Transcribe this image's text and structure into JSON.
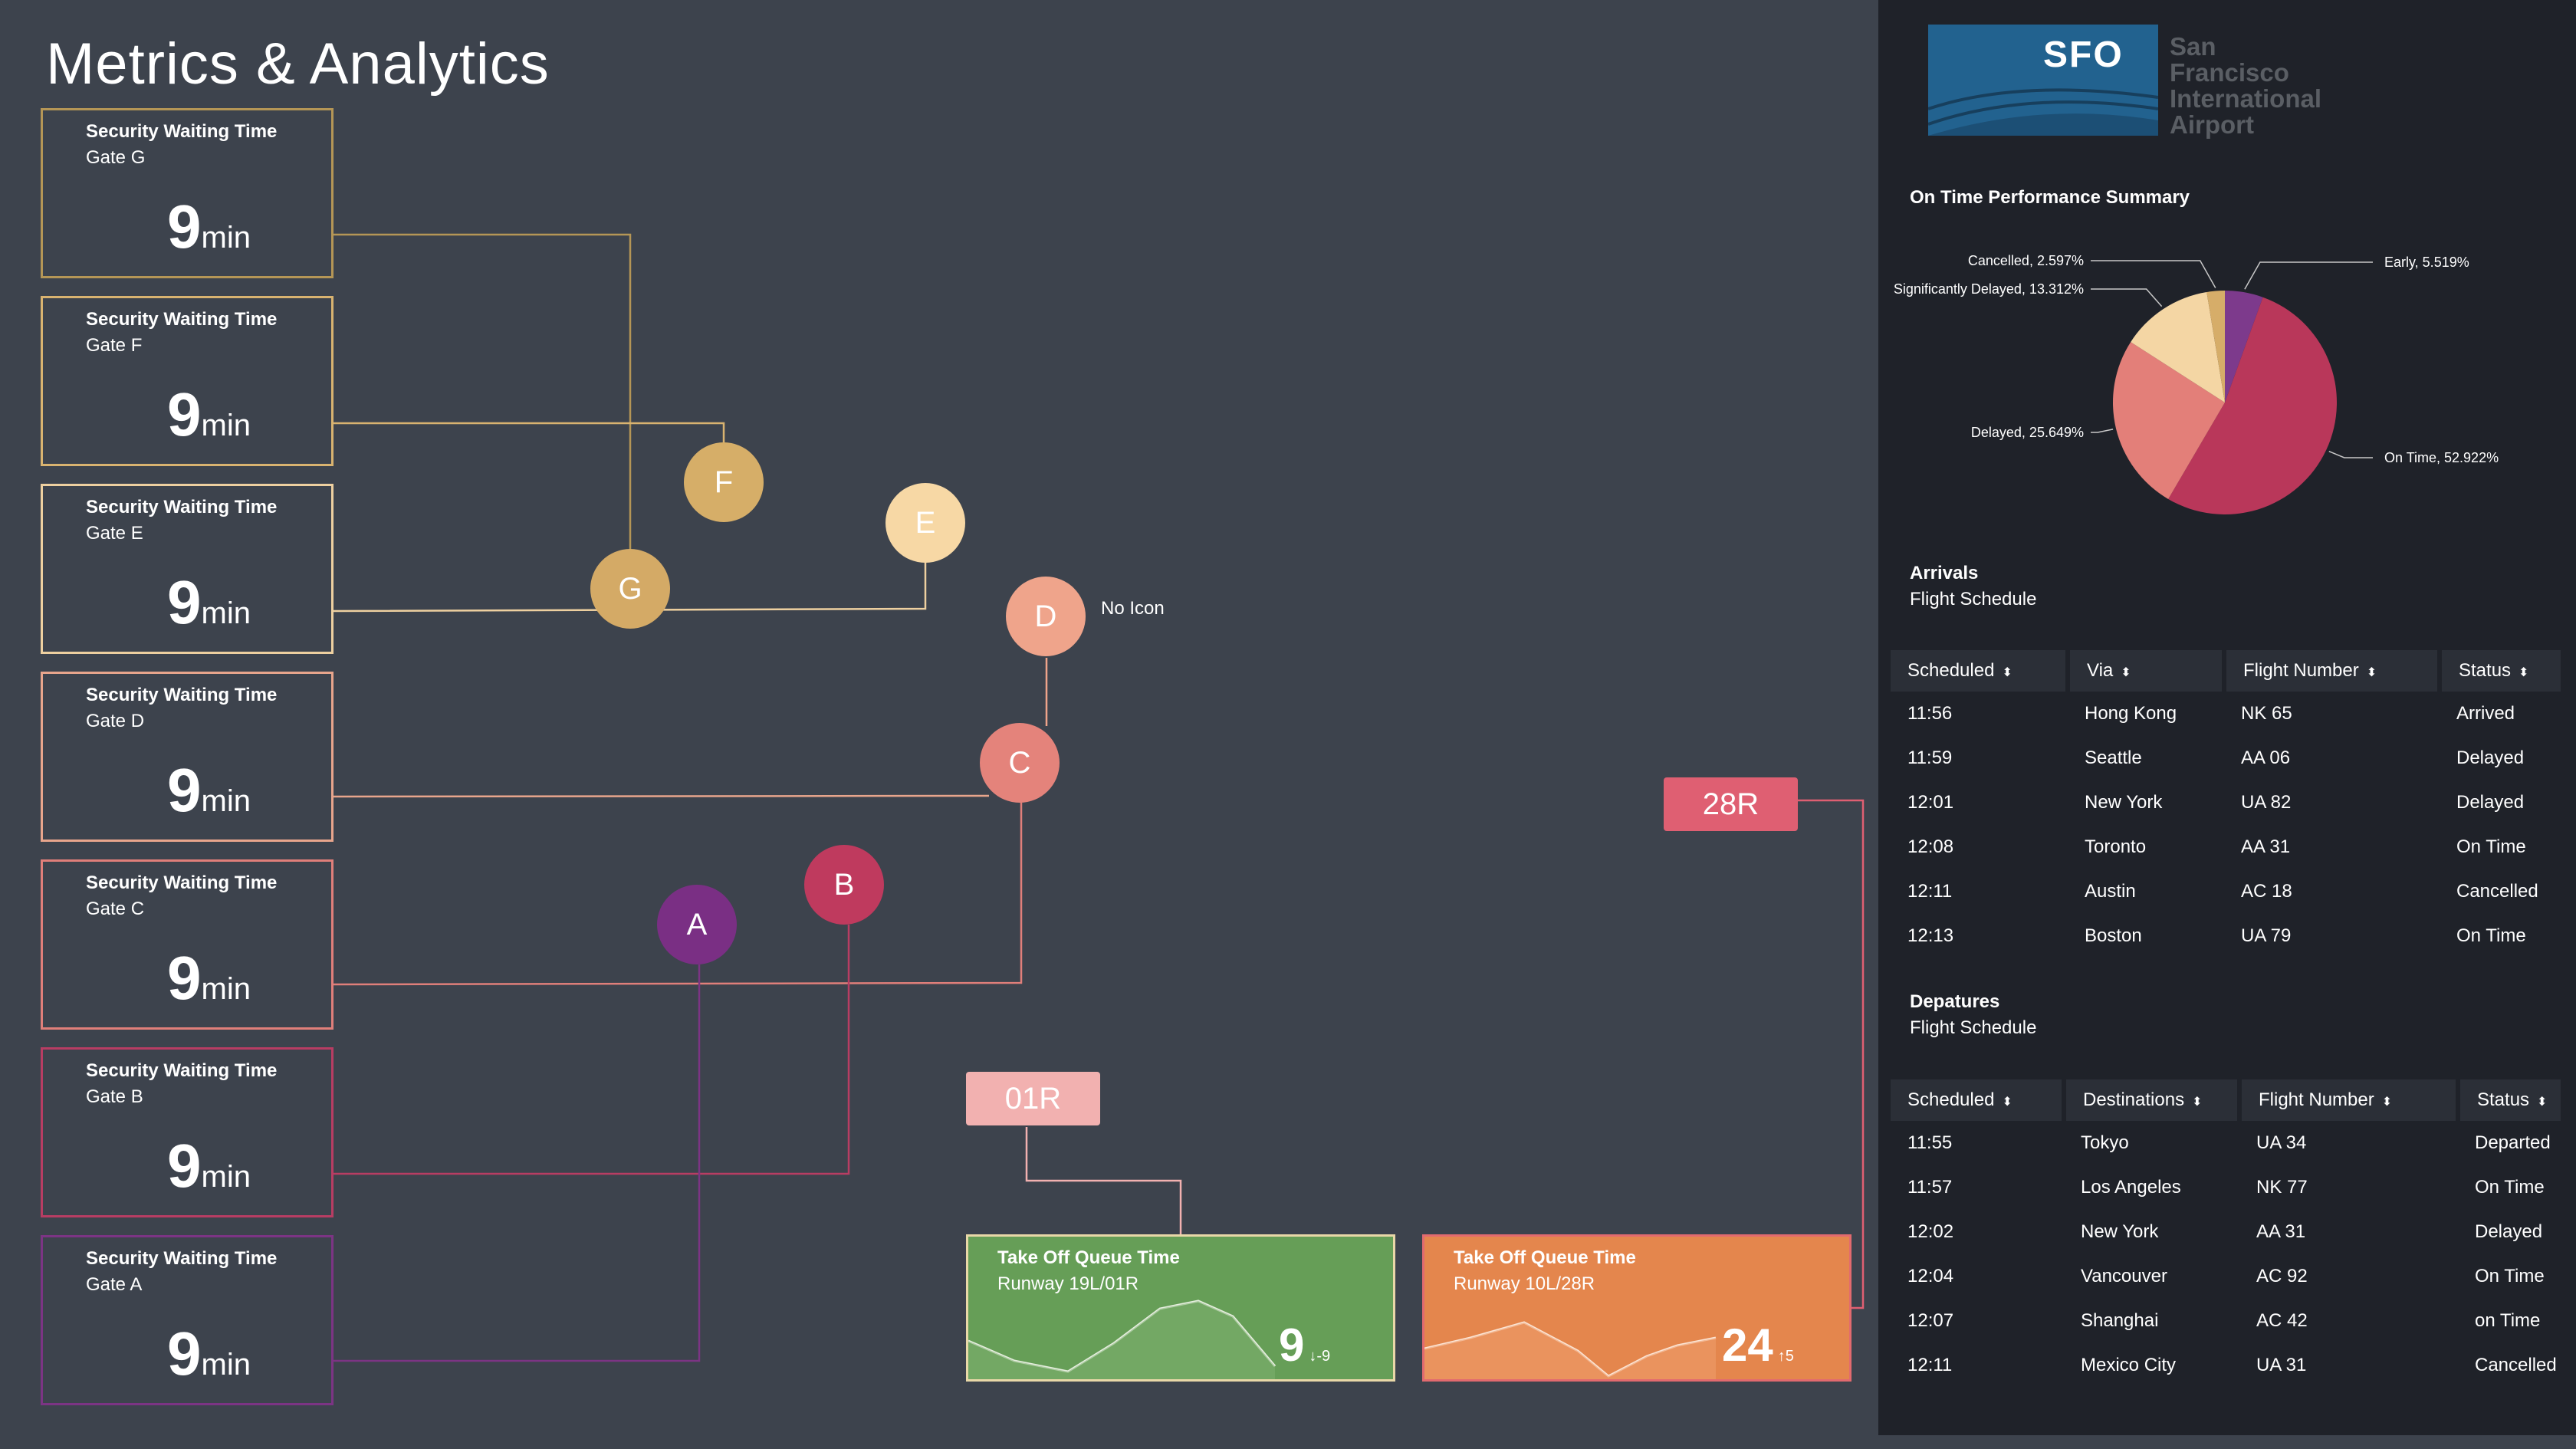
{
  "page_title": "Metrics & Analytics",
  "gates": [
    {
      "label": "Security Waiting Time",
      "gate": "Gate G",
      "value": "9",
      "unit": "min",
      "color": "#b59656"
    },
    {
      "label": "Security Waiting Time",
      "gate": "Gate F",
      "value": "9",
      "unit": "min",
      "color": "#d9b370"
    },
    {
      "label": "Security Waiting Time",
      "gate": "Gate E",
      "value": "9",
      "unit": "min",
      "color": "#eed0a0"
    },
    {
      "label": "Security Waiting Time",
      "gate": "Gate D",
      "value": "9",
      "unit": "min",
      "color": "#e8a58c"
    },
    {
      "label": "Security Waiting Time",
      "gate": "Gate C",
      "value": "9",
      "unit": "min",
      "color": "#e07f7a"
    },
    {
      "label": "Security Waiting Time",
      "gate": "Gate B",
      "value": "9",
      "unit": "min",
      "color": "#b83d63"
    },
    {
      "label": "Security Waiting Time",
      "gate": "Gate A",
      "value": "9",
      "unit": "min",
      "color": "#7c3484"
    }
  ],
  "nodes": [
    {
      "label": "A",
      "color": "#7a2f84"
    },
    {
      "label": "B",
      "color": "#bf3a5e"
    },
    {
      "label": "C",
      "color": "#e4837b"
    },
    {
      "label": "D",
      "color": "#efa48b"
    },
    {
      "label": "E",
      "color": "#f7d8a5"
    },
    {
      "label": "F",
      "color": "#d6ae68"
    },
    {
      "label": "G",
      "color": "#d4aa66"
    }
  ],
  "node_d_note": "No Icon",
  "runways": [
    {
      "label": "01R",
      "color": "#f2b1b0"
    },
    {
      "label": "28R",
      "color": "#df5f72"
    }
  ],
  "queues": [
    {
      "title": "Take Off Queue Time",
      "runway": "Runway 19L/01R",
      "value": "9",
      "delta": "↓-9",
      "color": "#669e57"
    },
    {
      "title": "Take Off Queue Time",
      "runway": "Runway 10L/28R",
      "value": "24",
      "delta": "↑5",
      "color": "#e4864d"
    }
  ],
  "logo": {
    "code": "SFO",
    "line1": "San Francisco",
    "line2": "International",
    "line3": "Airport"
  },
  "pie_title": "On Time Performance Summary",
  "chart_data": {
    "type": "pie",
    "title": "On Time Performance Summary",
    "slices": [
      {
        "label": "Early, 5.519%",
        "value": 5.519,
        "color": "#7d3a8c"
      },
      {
        "label": "On Time, 52.922%",
        "value": 52.922,
        "color": "#b9375a"
      },
      {
        "label": "Delayed, 25.649%",
        "value": 25.649,
        "color": "#e37f79"
      },
      {
        "label": "Significantly Delayed, 13.312%",
        "value": 13.312,
        "color": "#f4d6a4"
      },
      {
        "label": "Cancelled, 2.597%",
        "value": 2.597,
        "color": "#d6ad69"
      }
    ]
  },
  "arrivals": {
    "title": "Arrivals",
    "subtitle": "Flight Schedule",
    "headers": [
      "Scheduled",
      "Via",
      "Flight Number",
      "Status"
    ],
    "rows": [
      [
        "11:56",
        "Hong Kong",
        "NK 65",
        "Arrived"
      ],
      [
        "11:59",
        "Seattle",
        "AA 06",
        "Delayed"
      ],
      [
        "12:01",
        "New York",
        "UA 82",
        "Delayed"
      ],
      [
        "12:08",
        "Toronto",
        "AA 31",
        "On Time"
      ],
      [
        "12:11",
        "Austin",
        "AC 18",
        "Cancelled"
      ],
      [
        "12:13",
        "Boston",
        "UA 79",
        "On Time"
      ]
    ]
  },
  "departures": {
    "title": "Depatures",
    "subtitle": "Flight Schedule",
    "headers": [
      "Scheduled",
      "Destinations",
      "Flight Number",
      "Status"
    ],
    "rows": [
      [
        "11:55",
        "Tokyo",
        "UA 34",
        "Departed"
      ],
      [
        "11:57",
        "Los Angeles",
        "NK 77",
        "On Time"
      ],
      [
        "12:02",
        "New York",
        "AA 31",
        "Delayed"
      ],
      [
        "12:04",
        "Vancouver",
        "AC 92",
        "On Time"
      ],
      [
        "12:07",
        "Shanghai",
        "AC 42",
        "on Time"
      ],
      [
        "12:11",
        "Mexico City",
        "UA 31",
        "Cancelled"
      ]
    ]
  },
  "sort_icon": "⬍"
}
